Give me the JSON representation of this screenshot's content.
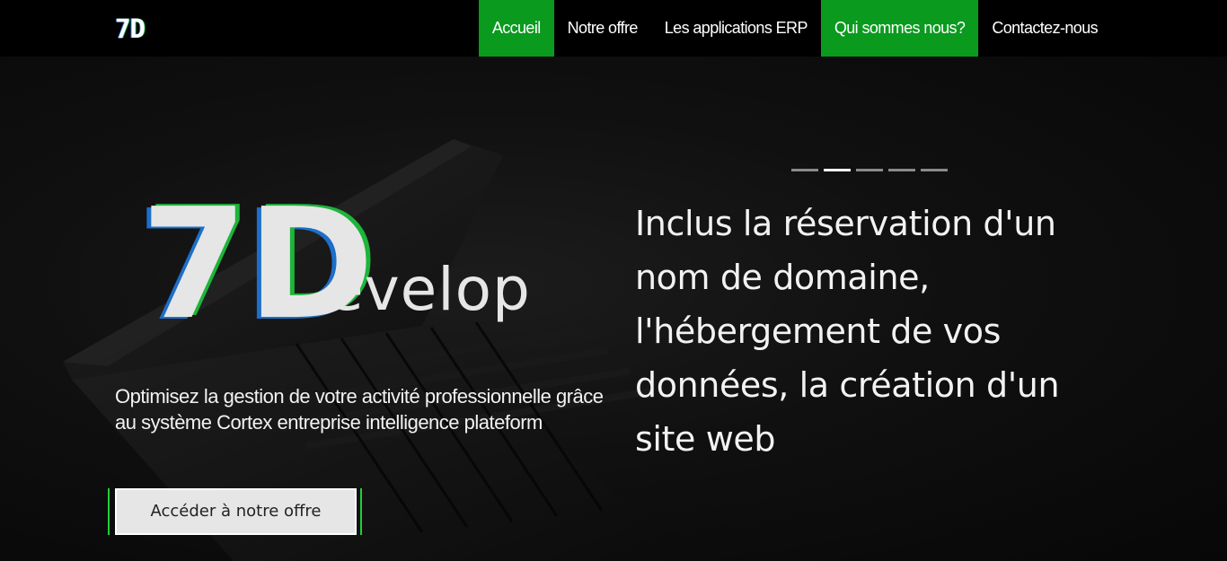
{
  "brand": {
    "label": "7D"
  },
  "nav": {
    "items": [
      {
        "label": "Accueil",
        "active": true
      },
      {
        "label": "Notre offre",
        "active": false
      },
      {
        "label": "Les applications ERP",
        "active": false
      },
      {
        "label": "Qui sommes nous?",
        "active": true
      },
      {
        "label": "Contactez-nous",
        "active": false
      }
    ]
  },
  "hero": {
    "logo": {
      "big": "7D",
      "rest": "evelop"
    },
    "tagline": "Optimisez la gestion de votre activité professionnelle grâce au système Cortex entreprise intelligence plateform",
    "cta_label": "Accéder à notre offre"
  },
  "carousel": {
    "indicator_count": 5,
    "active_index": 1,
    "slide_text": "Inclus la réservation d'un nom de domaine, l'hébergement de vos données, la création d'un site web"
  },
  "colors": {
    "accent_green": "#0a9a1e",
    "logo_blue": "#1c6fc9",
    "logo_green": "#1db53a"
  }
}
